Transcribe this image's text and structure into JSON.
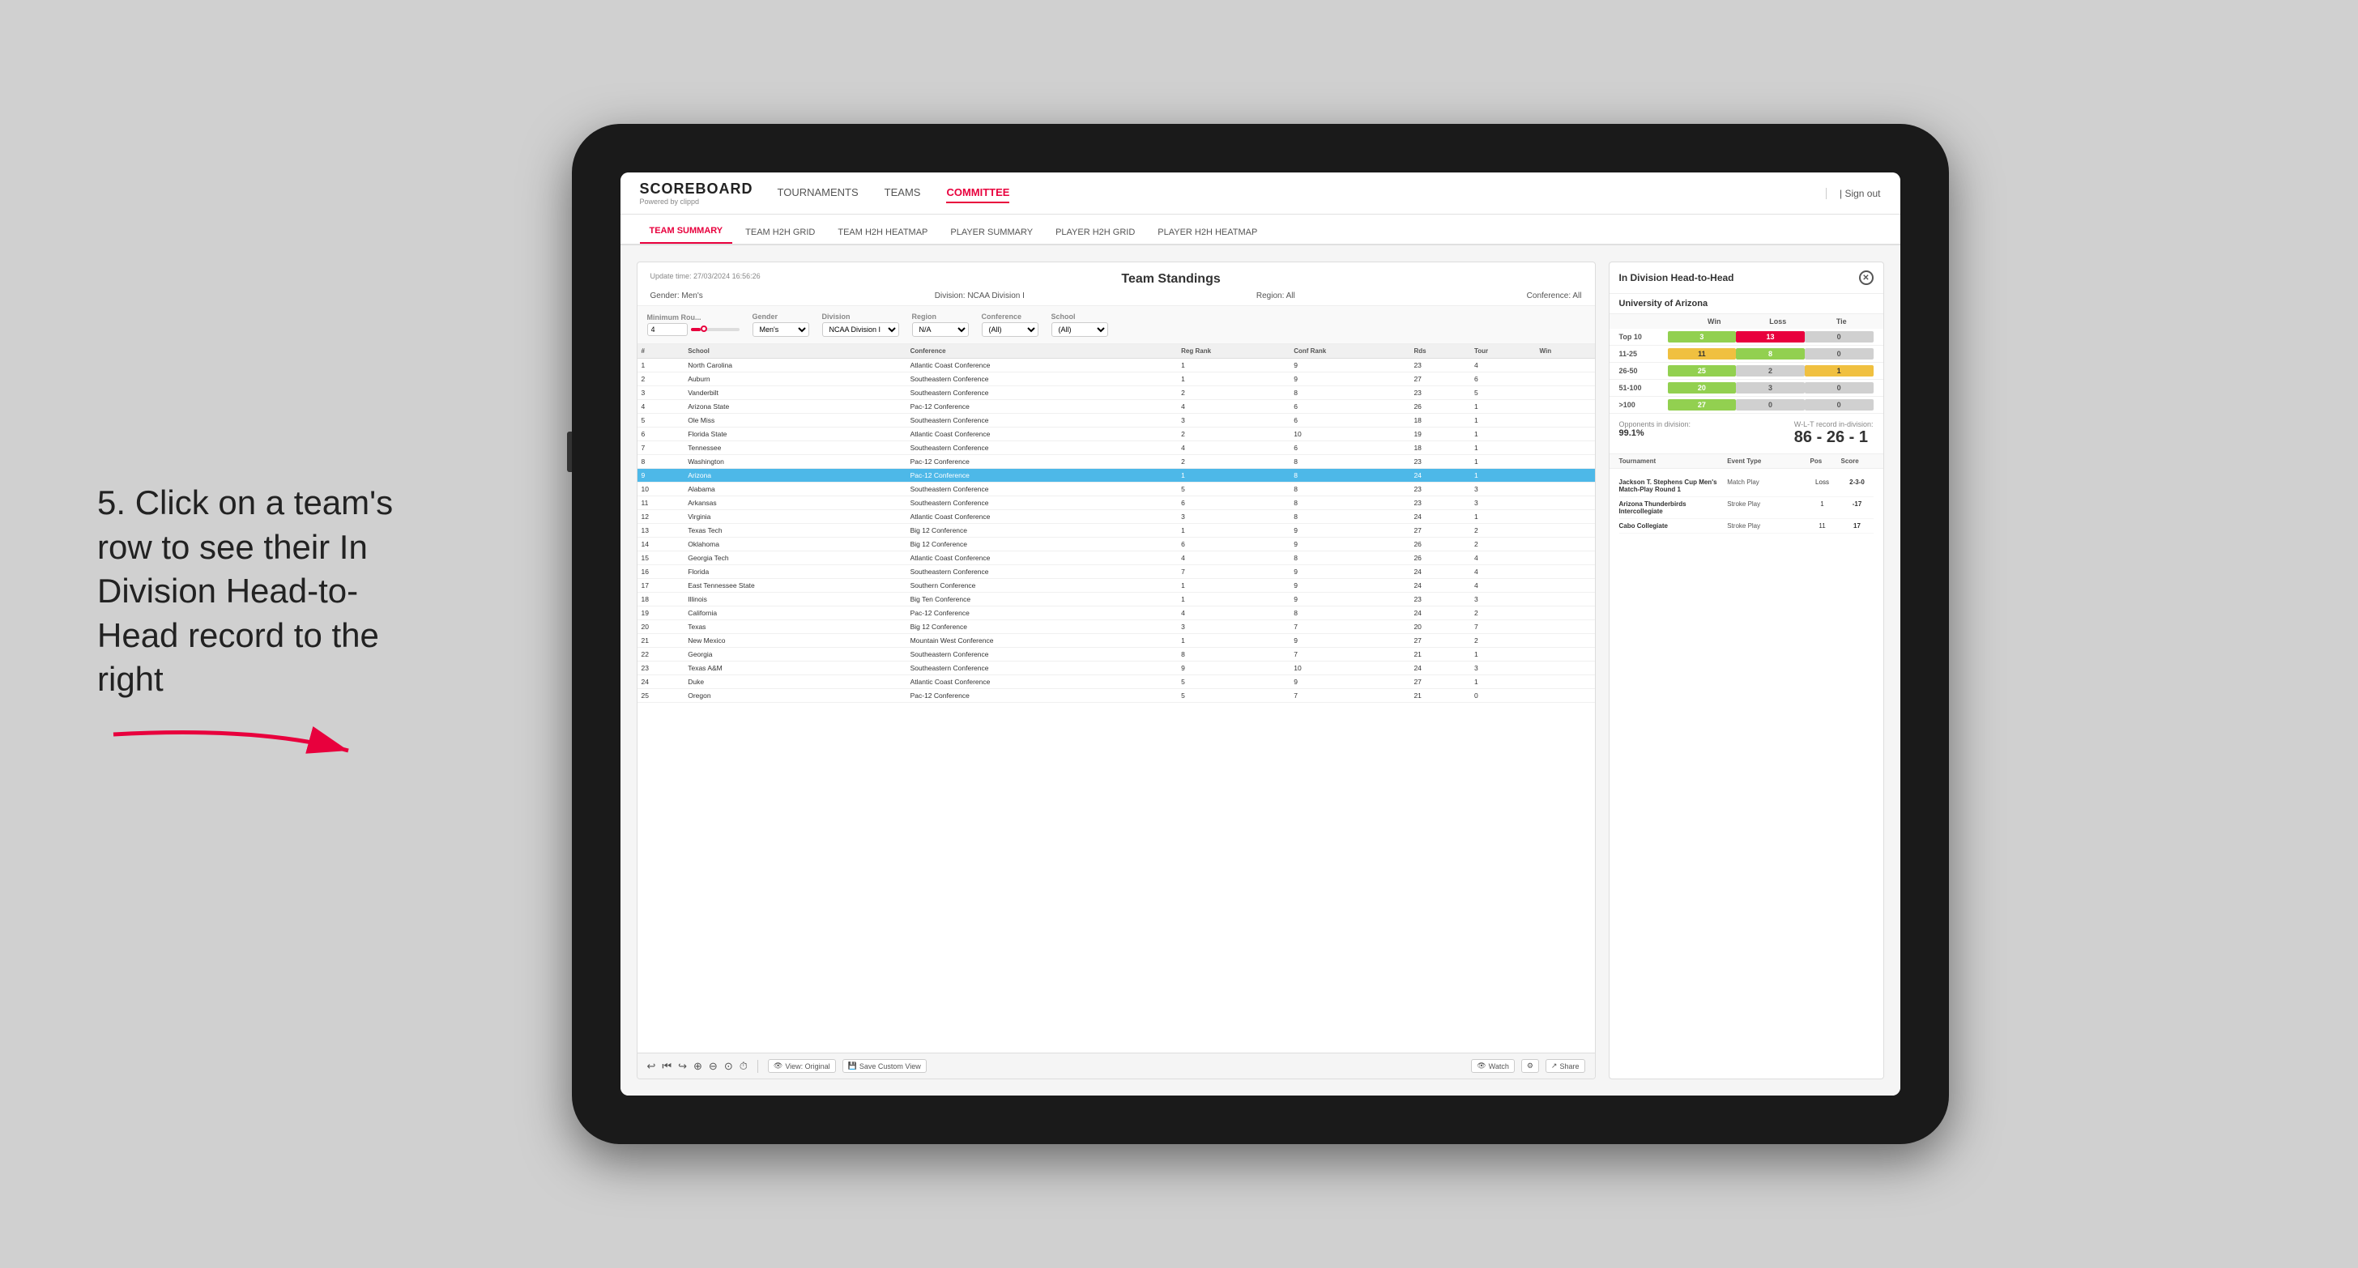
{
  "annotation": {
    "text": "5. Click on a team's row to see their In Division Head-to-Head record to the right"
  },
  "nav": {
    "logo": "SCOREBOARD",
    "logo_sub": "Powered by clippd",
    "items": [
      "TOURNAMENTS",
      "TEAMS",
      "COMMITTEE"
    ],
    "active_item": "COMMITTEE",
    "sign_out": "Sign out"
  },
  "sub_nav": {
    "items": [
      "TEAM SUMMARY",
      "TEAM H2H GRID",
      "TEAM H2H HEATMAP",
      "PLAYER SUMMARY",
      "PLAYER H2H GRID",
      "PLAYER H2H HEATMAP"
    ],
    "active_item": "PLAYER SUMMARY"
  },
  "panel": {
    "title": "Team Standings",
    "update_time": "Update time: 27/03/2024 16:56:26",
    "meta": {
      "gender": "Gender: Men's",
      "division": "Division: NCAA Division I",
      "region": "Region: All",
      "conference": "Conference: All"
    },
    "filters": {
      "minimum_rounds_label": "Minimum Rou...",
      "minimum_rounds_value": "4",
      "gender_label": "Gender",
      "gender_value": "Men's",
      "division_label": "Division",
      "division_value": "NCAA Division I",
      "region_label": "Region",
      "region_value": "N/A",
      "conference_label": "Conference",
      "conference_value": "(All)",
      "school_label": "School",
      "school_value": "(All)"
    },
    "columns": [
      "#",
      "School",
      "Conference",
      "Reg Rank",
      "Conf Rank",
      "Rds",
      "Tour",
      "Win"
    ],
    "rows": [
      {
        "num": 1,
        "school": "North Carolina",
        "conference": "Atlantic Coast Conference",
        "reg_rank": 1,
        "conf_rank": 9,
        "rds": 23,
        "tour": 4,
        "win": null,
        "selected": false
      },
      {
        "num": 2,
        "school": "Auburn",
        "conference": "Southeastern Conference",
        "reg_rank": 1,
        "conf_rank": 9,
        "rds": 27,
        "tour": 6,
        "win": null,
        "selected": false
      },
      {
        "num": 3,
        "school": "Vanderbilt",
        "conference": "Southeastern Conference",
        "reg_rank": 2,
        "conf_rank": 8,
        "rds": 23,
        "tour": 5,
        "win": null,
        "selected": false
      },
      {
        "num": 4,
        "school": "Arizona State",
        "conference": "Pac-12 Conference",
        "reg_rank": 4,
        "conf_rank": 6,
        "rds": 26,
        "tour": 1,
        "win": null,
        "selected": false
      },
      {
        "num": 5,
        "school": "Ole Miss",
        "conference": "Southeastern Conference",
        "reg_rank": 3,
        "conf_rank": 6,
        "rds": 18,
        "tour": 1,
        "win": null,
        "selected": false
      },
      {
        "num": 6,
        "school": "Florida State",
        "conference": "Atlantic Coast Conference",
        "reg_rank": 2,
        "conf_rank": 10,
        "rds": 19,
        "tour": 1,
        "win": null,
        "selected": false
      },
      {
        "num": 7,
        "school": "Tennessee",
        "conference": "Southeastern Conference",
        "reg_rank": 4,
        "conf_rank": 6,
        "rds": 18,
        "tour": 1,
        "win": null,
        "selected": false
      },
      {
        "num": 8,
        "school": "Washington",
        "conference": "Pac-12 Conference",
        "reg_rank": 2,
        "conf_rank": 8,
        "rds": 23,
        "tour": 1,
        "win": null,
        "selected": false
      },
      {
        "num": 9,
        "school": "Arizona",
        "conference": "Pac-12 Conference",
        "reg_rank": 1,
        "conf_rank": 8,
        "rds": 24,
        "tour": 1,
        "win": null,
        "selected": true
      },
      {
        "num": 10,
        "school": "Alabama",
        "conference": "Southeastern Conference",
        "reg_rank": 5,
        "conf_rank": 8,
        "rds": 23,
        "tour": 3,
        "win": null,
        "selected": false
      },
      {
        "num": 11,
        "school": "Arkansas",
        "conference": "Southeastern Conference",
        "reg_rank": 6,
        "conf_rank": 8,
        "rds": 23,
        "tour": 3,
        "win": null,
        "selected": false
      },
      {
        "num": 12,
        "school": "Virginia",
        "conference": "Atlantic Coast Conference",
        "reg_rank": 3,
        "conf_rank": 8,
        "rds": 24,
        "tour": 1,
        "win": null,
        "selected": false
      },
      {
        "num": 13,
        "school": "Texas Tech",
        "conference": "Big 12 Conference",
        "reg_rank": 1,
        "conf_rank": 9,
        "rds": 27,
        "tour": 2,
        "win": null,
        "selected": false
      },
      {
        "num": 14,
        "school": "Oklahoma",
        "conference": "Big 12 Conference",
        "reg_rank": 6,
        "conf_rank": 9,
        "rds": 26,
        "tour": 2,
        "win": null,
        "selected": false
      },
      {
        "num": 15,
        "school": "Georgia Tech",
        "conference": "Atlantic Coast Conference",
        "reg_rank": 4,
        "conf_rank": 8,
        "rds": 26,
        "tour": 4,
        "win": null,
        "selected": false
      },
      {
        "num": 16,
        "school": "Florida",
        "conference": "Southeastern Conference",
        "reg_rank": 7,
        "conf_rank": 9,
        "rds": 24,
        "tour": 4,
        "win": null,
        "selected": false
      },
      {
        "num": 17,
        "school": "East Tennessee State",
        "conference": "Southern Conference",
        "reg_rank": 1,
        "conf_rank": 9,
        "rds": 24,
        "tour": 4,
        "win": null,
        "selected": false
      },
      {
        "num": 18,
        "school": "Illinois",
        "conference": "Big Ten Conference",
        "reg_rank": 1,
        "conf_rank": 9,
        "rds": 23,
        "tour": 3,
        "win": null,
        "selected": false
      },
      {
        "num": 19,
        "school": "California",
        "conference": "Pac-12 Conference",
        "reg_rank": 4,
        "conf_rank": 8,
        "rds": 24,
        "tour": 2,
        "win": null,
        "selected": false
      },
      {
        "num": 20,
        "school": "Texas",
        "conference": "Big 12 Conference",
        "reg_rank": 3,
        "conf_rank": 7,
        "rds": 20,
        "tour": 7,
        "win": null,
        "selected": false
      },
      {
        "num": 21,
        "school": "New Mexico",
        "conference": "Mountain West Conference",
        "reg_rank": 1,
        "conf_rank": 9,
        "rds": 27,
        "tour": 2,
        "win": null,
        "selected": false
      },
      {
        "num": 22,
        "school": "Georgia",
        "conference": "Southeastern Conference",
        "reg_rank": 8,
        "conf_rank": 7,
        "rds": 21,
        "tour": 1,
        "win": null,
        "selected": false
      },
      {
        "num": 23,
        "school": "Texas A&M",
        "conference": "Southeastern Conference",
        "reg_rank": 9,
        "conf_rank": 10,
        "rds": 24,
        "tour": 3,
        "win": null,
        "selected": false
      },
      {
        "num": 24,
        "school": "Duke",
        "conference": "Atlantic Coast Conference",
        "reg_rank": 5,
        "conf_rank": 9,
        "rds": 27,
        "tour": 1,
        "win": null,
        "selected": false
      },
      {
        "num": 25,
        "school": "Oregon",
        "conference": "Pac-12 Conference",
        "reg_rank": 5,
        "conf_rank": 7,
        "rds": 21,
        "tour": 0,
        "win": null,
        "selected": false
      }
    ]
  },
  "h2h": {
    "title": "In Division Head-to-Head",
    "team": "University of Arizona",
    "headers": [
      "",
      "Win",
      "Loss",
      "Tie"
    ],
    "rows": [
      {
        "range": "Top 10",
        "win": 3,
        "loss": 13,
        "tie": 0,
        "win_color": "green",
        "loss_color": "red"
      },
      {
        "range": "11-25",
        "win": 11,
        "loss": 8,
        "tie": 0,
        "win_color": "yellow",
        "loss_color": "green"
      },
      {
        "range": "26-50",
        "win": 25,
        "loss": 2,
        "tie": 1,
        "win_color": "green",
        "loss_color": "gray"
      },
      {
        "range": "51-100",
        "win": 20,
        "loss": 3,
        "tie": 0,
        "win_color": "green",
        "loss_color": "gray"
      },
      {
        "range": ">100",
        "win": 27,
        "loss": 0,
        "tie": 0,
        "win_color": "green",
        "loss_color": "gray"
      }
    ],
    "opponents_pct_label": "Opponents in division:",
    "opponents_pct": "99.1%",
    "record_label": "W-L-T record in-division:",
    "record": "86 - 26 - 1",
    "tournaments": [
      {
        "name": "Jackson T. Stephens Cup Men's Match-Play Round 1",
        "event_type": "Match Play",
        "pos_label": "Pos",
        "pos": "Loss",
        "score": "2-3-0"
      },
      {
        "name": "Arizona Thunderbirds Intercollegiate",
        "event_type": "Stroke Play",
        "pos": 1,
        "score": "-17"
      },
      {
        "name": "Cabo Collegiate",
        "event_type": "Stroke Play",
        "pos": 11,
        "score": "17"
      }
    ]
  },
  "toolbar": {
    "undo": "↩",
    "redo": "↪",
    "forward": "→",
    "icons": [
      "↩",
      "↪",
      "→",
      "⊕",
      "⊗",
      "⊙",
      "⏱"
    ],
    "view_original": "View: Original",
    "save_custom": "Save Custom View",
    "watch": "Watch",
    "settings": "⚙",
    "share": "Share"
  }
}
